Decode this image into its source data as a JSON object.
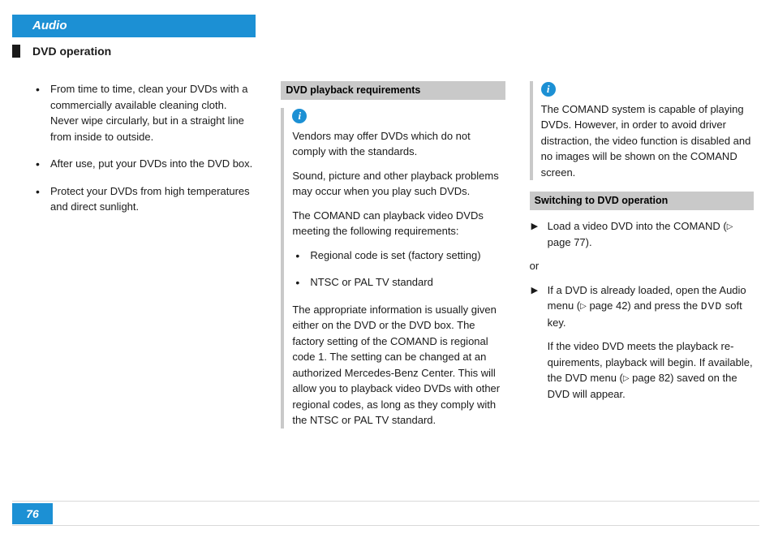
{
  "header": {
    "title": "Audio",
    "subtitle": "DVD operation"
  },
  "page_number": "76",
  "col1": {
    "bullets": [
      "From time to time, clean your DVDs with a commercially available cleaning cloth. Never wipe circularly, but in a straight line from inside to outside.",
      "After use, put your DVDs into the DVD box.",
      "Protect your DVDs from high temperatures and direct sunlight."
    ]
  },
  "col2": {
    "section_title": "DVD playback requirements",
    "info_p1": "Vendors may offer DVDs which do not comply with the standards.",
    "info_p2": "Sound, picture and other playback problems may occur when you play such DVDs.",
    "info_p3": "The COMAND can playback video DVDs meeting the following requirements:",
    "info_bullets": [
      "Regional code is set (factory setting)",
      "NTSC or PAL TV standard"
    ],
    "info_p4": "The appropriate information is usually given either on the DVD or the DVD box. The factory setting of the COMAND is regional code 1. The setting can be changed at an authorized Mercedes-Benz Center. This will allow you to playback video DVDs with other regional codes, as long as they comply with the NTSC or PAL TV standard."
  },
  "col3": {
    "info_p1": "The COMAND system is capable of playing DVDs. However, in order to avoid driver distraction, the video function is disabled and no images will be shown on the COMAND screen.",
    "section_title": "Switching to DVD operation",
    "step1_a": "Load a video DVD into the COMAND (",
    "step1_ref": " page 77).",
    "or": "or",
    "step2_a": "If a DVD is already loaded, open the Au­dio menu (",
    "step2_ref": " page 42) and press the ",
    "step2_softkey": "DVD",
    "step2_b": " soft key.",
    "step2_p2_a": "If the video DVD meets the playback re­quirements, playback will begin. If avai­lable, the DVD menu (",
    "step2_p2_ref": " page 82) saved on the DVD will appear."
  }
}
